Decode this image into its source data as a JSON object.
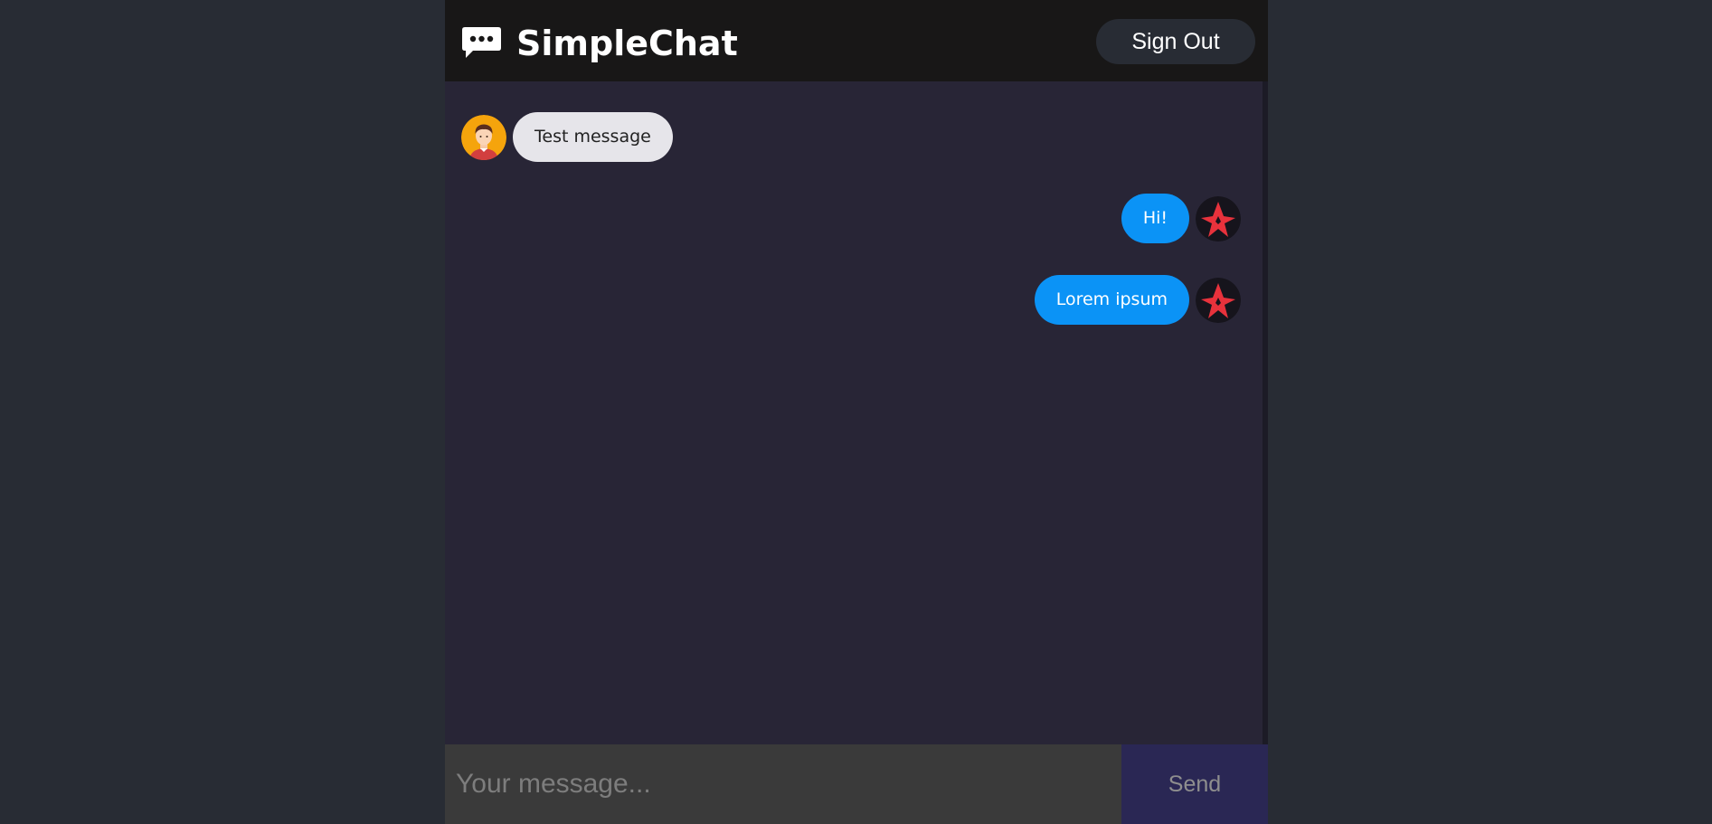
{
  "header": {
    "title": "SimpleChat",
    "logo_icon": "chat-bubble-icon",
    "signout_label": "Sign Out"
  },
  "messages": [
    {
      "text": "Test message",
      "type": "received",
      "avatar": "user-avatar"
    },
    {
      "text": "Hi!",
      "type": "sent",
      "avatar": "star-logo-avatar"
    },
    {
      "text": "Lorem ipsum",
      "type": "sent",
      "avatar": "star-logo-avatar"
    }
  ],
  "composer": {
    "placeholder": "Your message...",
    "value": "",
    "send_label": "Send"
  },
  "colors": {
    "page_bg": "#282c34",
    "header_bg": "#181717",
    "chat_bg": "#282536",
    "sent_bubble": "#0b93f6",
    "received_bubble": "#e6e5ea",
    "send_button_bg": "#2a2754",
    "input_bg": "#3a3a3a",
    "star_logo_red": "#e8323c"
  }
}
